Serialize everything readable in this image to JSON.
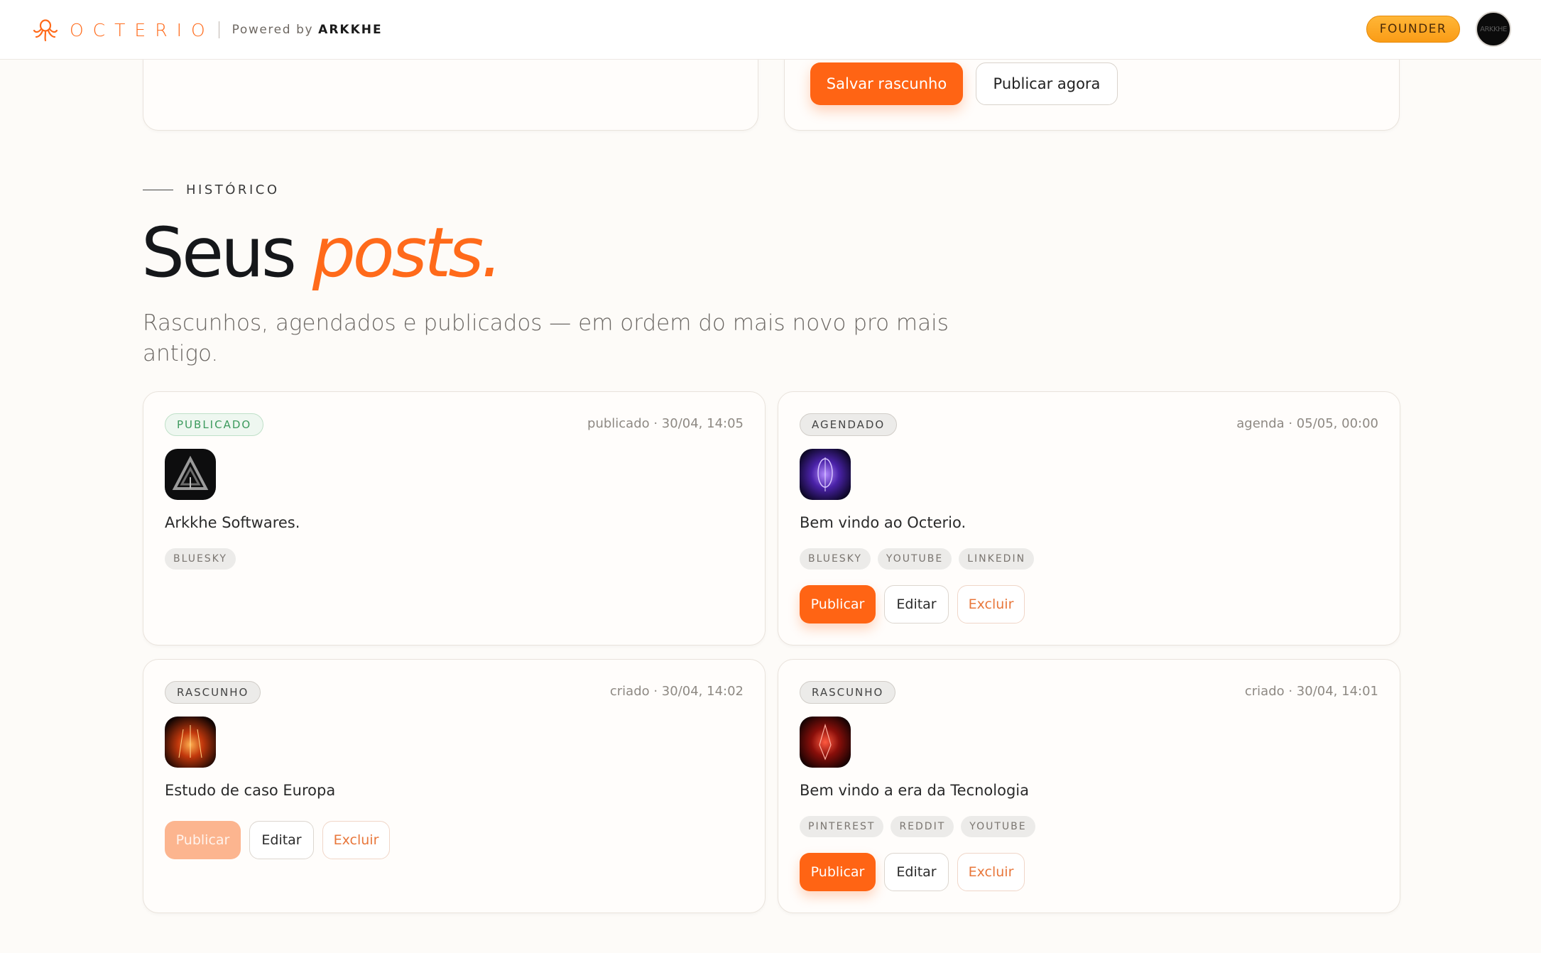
{
  "header": {
    "brand": "OCTERIO",
    "powered_prefix": "Powered by",
    "powered_name": "ARKKHE",
    "plan_badge": "FOUNDER",
    "avatar_text": "ARKKHE"
  },
  "composer": {
    "save_label": "Salvar rascunho",
    "publish_now_label": "Publicar agora"
  },
  "history": {
    "eyebrow": "HISTÓRICO",
    "title_main": "Seus",
    "title_accent": "posts.",
    "lead": "Rascunhos, agendados e publicados — em ordem do mais novo pro mais antigo."
  },
  "posts": [
    {
      "status": "PUBLICADO",
      "meta": "publicado · 30/04, 14:05",
      "title": "Arkkhe Softwares.",
      "tags": [
        "BLUESKY"
      ]
    },
    {
      "status": "AGENDADO",
      "meta": "agenda · 05/05, 00:00",
      "title": "Bem vindo ao Octerio.",
      "tags": [
        "BLUESKY",
        "YOUTUBE",
        "LINKEDIN"
      ],
      "actions": {
        "publish": "Publicar",
        "edit": "Editar",
        "delete": "Excluir"
      }
    },
    {
      "status": "RASCUNHO",
      "meta": "criado · 30/04, 14:02",
      "title": "Estudo de caso Europa",
      "tags": [],
      "actions": {
        "publish": "Publicar",
        "edit": "Editar",
        "delete": "Excluir"
      }
    },
    {
      "status": "RASCUNHO",
      "meta": "criado · 30/04, 14:01",
      "title": "Bem vindo a era da Tecnologia",
      "tags": [
        "PINTEREST",
        "REDDIT",
        "YOUTUBE"
      ],
      "actions": {
        "publish": "Publicar",
        "edit": "Editar",
        "delete": "Excluir"
      }
    }
  ],
  "colors": {
    "accent": "#ff6414",
    "background": "#fdfbf8",
    "published": "#3c9a5d",
    "founder": "#fa9c16"
  },
  "icons": [
    "octopus-logo-icon"
  ]
}
